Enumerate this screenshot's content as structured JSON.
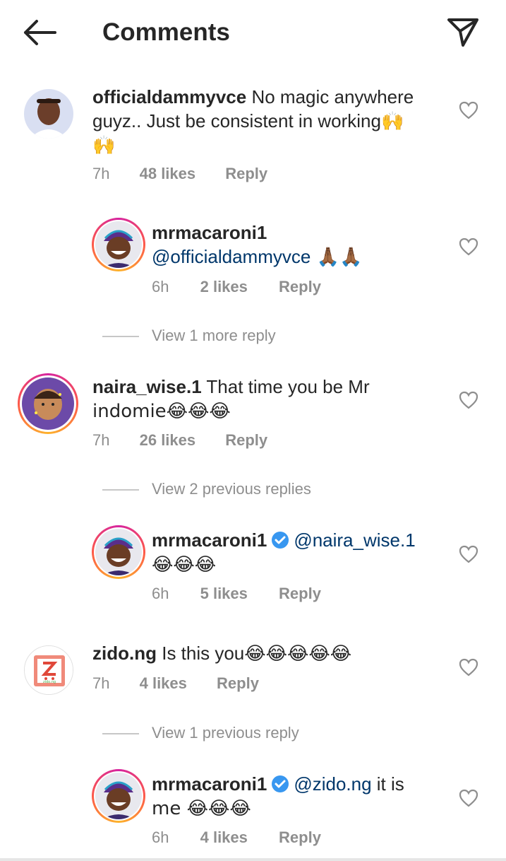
{
  "header": {
    "title": "Comments"
  },
  "comments": [
    {
      "username": "officialdammyvce",
      "text": "No magic anywhere guyz.. Just be consistent in working🙌",
      "text_line2": "🙌",
      "time": "7h",
      "likes": "48 likes",
      "reply": "Reply"
    },
    {
      "username": "mrmacaroni1",
      "mention": "@officialdammyvce",
      "text": " 🙏🏾🙏🏾",
      "time": "6h",
      "likes": "2 likes",
      "reply": "Reply"
    },
    {
      "view_more": "View 1 more reply"
    },
    {
      "username": "naira_wise.1",
      "text": "That time you be Mr",
      "text_line2": "indomie😂😂😂",
      "time": "7h",
      "likes": "26 likes",
      "reply": "Reply"
    },
    {
      "view_more": "View 2 previous replies"
    },
    {
      "username": "mrmacaroni1",
      "mention": "@naira_wise.1",
      "text": "😂😂😂",
      "time": "6h",
      "likes": "5 likes",
      "reply": "Reply"
    },
    {
      "username": "zido.ng",
      "text": "Is this you😂😂😂😂😂",
      "time": "7h",
      "likes": "4 likes",
      "reply": "Reply",
      "avatar_text": "zido.ng"
    },
    {
      "view_more": "View 1 previous reply"
    },
    {
      "username": "mrmacaroni1",
      "mention": "@zido.ng",
      "text": " it is",
      "text_line2": "me 😂😂😂",
      "time": "6h",
      "likes": "4 likes",
      "reply": "Reply"
    }
  ],
  "colors": {
    "mention": "#00376b",
    "meta": "#8e8e8e",
    "verified": "#3897f0"
  },
  "icons": [
    "back-arrow-icon",
    "send-icon",
    "heart-icon",
    "verified-icon"
  ]
}
